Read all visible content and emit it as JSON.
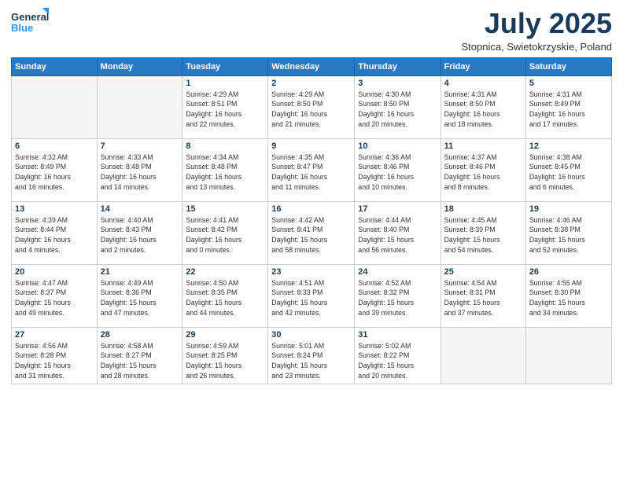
{
  "logo": {
    "line1": "General",
    "line2": "Blue"
  },
  "title": "July 2025",
  "location": "Stopnica, Swietokrzyskie, Poland",
  "weekdays": [
    "Sunday",
    "Monday",
    "Tuesday",
    "Wednesday",
    "Thursday",
    "Friday",
    "Saturday"
  ],
  "weeks": [
    [
      {
        "day": "",
        "info": ""
      },
      {
        "day": "",
        "info": ""
      },
      {
        "day": "1",
        "info": "Sunrise: 4:29 AM\nSunset: 8:51 PM\nDaylight: 16 hours\nand 22 minutes."
      },
      {
        "day": "2",
        "info": "Sunrise: 4:29 AM\nSunset: 8:50 PM\nDaylight: 16 hours\nand 21 minutes."
      },
      {
        "day": "3",
        "info": "Sunrise: 4:30 AM\nSunset: 8:50 PM\nDaylight: 16 hours\nand 20 minutes."
      },
      {
        "day": "4",
        "info": "Sunrise: 4:31 AM\nSunset: 8:50 PM\nDaylight: 16 hours\nand 18 minutes."
      },
      {
        "day": "5",
        "info": "Sunrise: 4:31 AM\nSunset: 8:49 PM\nDaylight: 16 hours\nand 17 minutes."
      }
    ],
    [
      {
        "day": "6",
        "info": "Sunrise: 4:32 AM\nSunset: 8:49 PM\nDaylight: 16 hours\nand 16 minutes."
      },
      {
        "day": "7",
        "info": "Sunrise: 4:33 AM\nSunset: 8:48 PM\nDaylight: 16 hours\nand 14 minutes."
      },
      {
        "day": "8",
        "info": "Sunrise: 4:34 AM\nSunset: 8:48 PM\nDaylight: 16 hours\nand 13 minutes."
      },
      {
        "day": "9",
        "info": "Sunrise: 4:35 AM\nSunset: 8:47 PM\nDaylight: 16 hours\nand 11 minutes."
      },
      {
        "day": "10",
        "info": "Sunrise: 4:36 AM\nSunset: 8:46 PM\nDaylight: 16 hours\nand 10 minutes."
      },
      {
        "day": "11",
        "info": "Sunrise: 4:37 AM\nSunset: 8:46 PM\nDaylight: 16 hours\nand 8 minutes."
      },
      {
        "day": "12",
        "info": "Sunrise: 4:38 AM\nSunset: 8:45 PM\nDaylight: 16 hours\nand 6 minutes."
      }
    ],
    [
      {
        "day": "13",
        "info": "Sunrise: 4:39 AM\nSunset: 8:44 PM\nDaylight: 16 hours\nand 4 minutes."
      },
      {
        "day": "14",
        "info": "Sunrise: 4:40 AM\nSunset: 8:43 PM\nDaylight: 16 hours\nand 2 minutes."
      },
      {
        "day": "15",
        "info": "Sunrise: 4:41 AM\nSunset: 8:42 PM\nDaylight: 16 hours\nand 0 minutes."
      },
      {
        "day": "16",
        "info": "Sunrise: 4:42 AM\nSunset: 8:41 PM\nDaylight: 15 hours\nand 58 minutes."
      },
      {
        "day": "17",
        "info": "Sunrise: 4:44 AM\nSunset: 8:40 PM\nDaylight: 15 hours\nand 56 minutes."
      },
      {
        "day": "18",
        "info": "Sunrise: 4:45 AM\nSunset: 8:39 PM\nDaylight: 15 hours\nand 54 minutes."
      },
      {
        "day": "19",
        "info": "Sunrise: 4:46 AM\nSunset: 8:38 PM\nDaylight: 15 hours\nand 52 minutes."
      }
    ],
    [
      {
        "day": "20",
        "info": "Sunrise: 4:47 AM\nSunset: 8:37 PM\nDaylight: 15 hours\nand 49 minutes."
      },
      {
        "day": "21",
        "info": "Sunrise: 4:49 AM\nSunset: 8:36 PM\nDaylight: 15 hours\nand 47 minutes."
      },
      {
        "day": "22",
        "info": "Sunrise: 4:50 AM\nSunset: 8:35 PM\nDaylight: 15 hours\nand 44 minutes."
      },
      {
        "day": "23",
        "info": "Sunrise: 4:51 AM\nSunset: 8:33 PM\nDaylight: 15 hours\nand 42 minutes."
      },
      {
        "day": "24",
        "info": "Sunrise: 4:52 AM\nSunset: 8:32 PM\nDaylight: 15 hours\nand 39 minutes."
      },
      {
        "day": "25",
        "info": "Sunrise: 4:54 AM\nSunset: 8:31 PM\nDaylight: 15 hours\nand 37 minutes."
      },
      {
        "day": "26",
        "info": "Sunrise: 4:55 AM\nSunset: 8:30 PM\nDaylight: 15 hours\nand 34 minutes."
      }
    ],
    [
      {
        "day": "27",
        "info": "Sunrise: 4:56 AM\nSunset: 8:28 PM\nDaylight: 15 hours\nand 31 minutes."
      },
      {
        "day": "28",
        "info": "Sunrise: 4:58 AM\nSunset: 8:27 PM\nDaylight: 15 hours\nand 28 minutes."
      },
      {
        "day": "29",
        "info": "Sunrise: 4:59 AM\nSunset: 8:25 PM\nDaylight: 15 hours\nand 26 minutes."
      },
      {
        "day": "30",
        "info": "Sunrise: 5:01 AM\nSunset: 8:24 PM\nDaylight: 15 hours\nand 23 minutes."
      },
      {
        "day": "31",
        "info": "Sunrise: 5:02 AM\nSunset: 8:22 PM\nDaylight: 15 hours\nand 20 minutes."
      },
      {
        "day": "",
        "info": ""
      },
      {
        "day": "",
        "info": ""
      }
    ]
  ]
}
